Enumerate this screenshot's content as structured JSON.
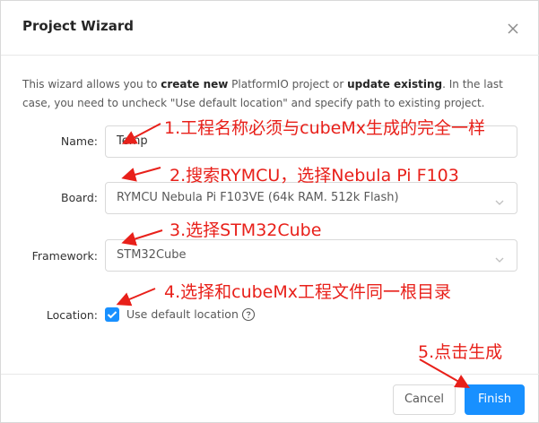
{
  "dialog": {
    "title": "Project Wizard",
    "description": {
      "p1": "This wizard allows you to ",
      "b1": "create new",
      "p2": " PlatformIO project or ",
      "b2": "update existing",
      "p3": ". In the last case, you need to uncheck \"Use default location\" and specify path to existing project."
    }
  },
  "form": {
    "name_label": "Name:",
    "name_value": "Temp",
    "board_label": "Board:",
    "board_value": "RYMCU Nebula Pi F103VE (64k RAM. 512k Flash)",
    "framework_label": "Framework:",
    "framework_value": "STM32Cube",
    "location_label": "Location:",
    "use_default_label": "Use default location",
    "use_default_checked": true
  },
  "footer": {
    "cancel_label": "Cancel",
    "finish_label": "Finish"
  },
  "annotations": {
    "a1": "1.工程名称必须与cubeMx生成的完全一样",
    "a2": "2.搜索RYMCU，选择Nebula Pi F103",
    "a3": "3.选择STM32Cube",
    "a4": "4.选择和cubeMx工程文件同一根目录",
    "a5": "5.点击生成"
  },
  "icons": {
    "close": "close-icon",
    "chevron": "chevron-down-icon",
    "check": "check-icon",
    "help": "question-circle-icon"
  },
  "colors": {
    "primary": "#1890ff",
    "annotation": "#e8201a"
  }
}
